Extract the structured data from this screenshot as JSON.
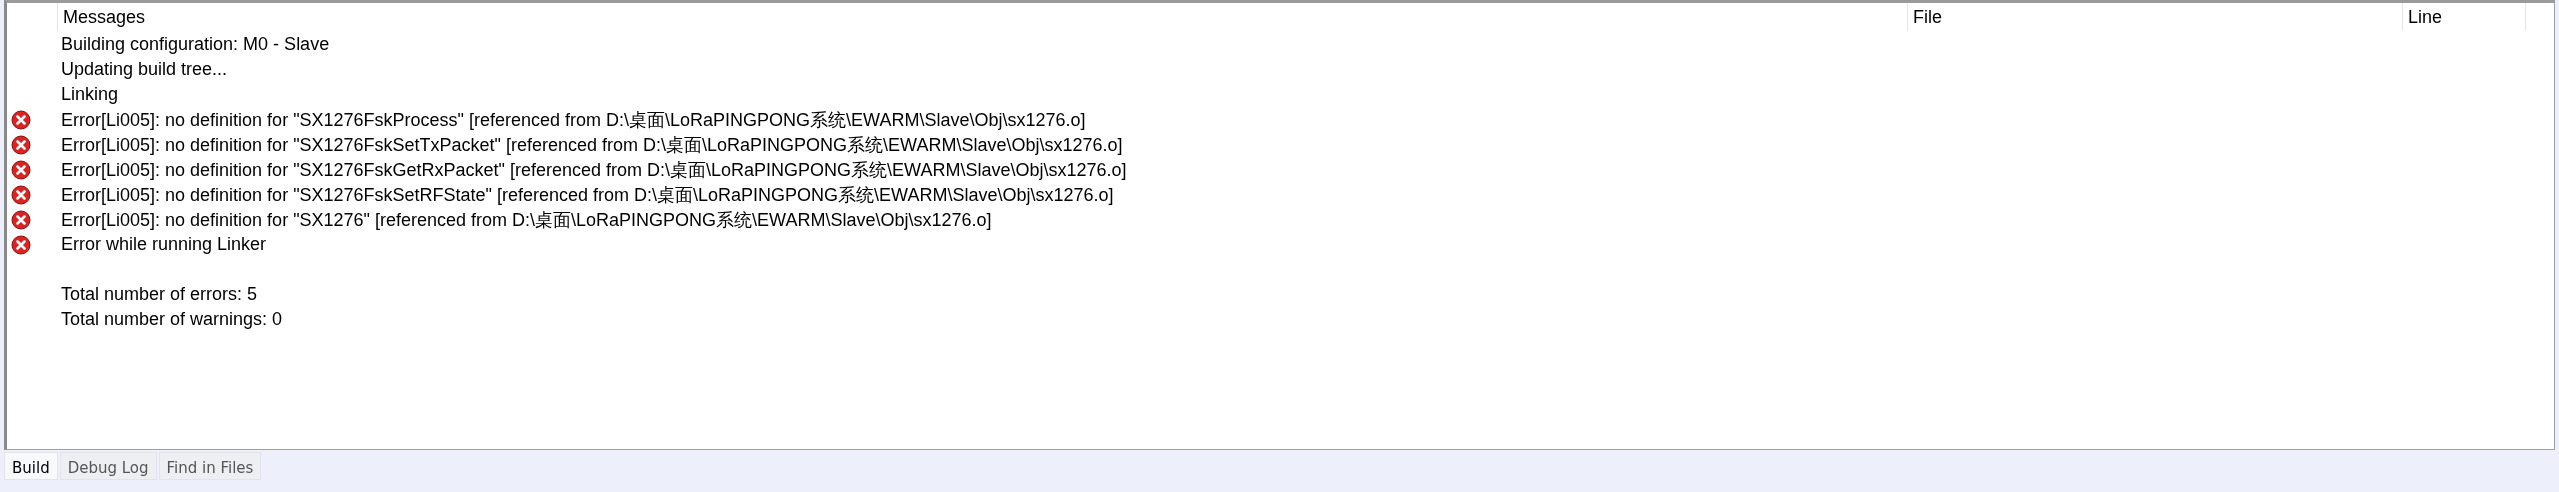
{
  "table": {
    "columns": [
      "Messages",
      "File",
      "Line"
    ],
    "rows": [
      {
        "kind": "info",
        "text": "Building configuration: M0 - Slave"
      },
      {
        "kind": "info",
        "text": "Updating build tree..."
      },
      {
        "kind": "info",
        "text": "Linking"
      },
      {
        "kind": "error",
        "text": "Error[Li005]: no definition for \"SX1276FskProcess\" [referenced from D:\\桌面\\LoRaPINGPONG系统\\EWARM\\Slave\\Obj\\sx1276.o]"
      },
      {
        "kind": "error",
        "text": "Error[Li005]: no definition for \"SX1276FskSetTxPacket\" [referenced from D:\\桌面\\LoRaPINGPONG系统\\EWARM\\Slave\\Obj\\sx1276.o]"
      },
      {
        "kind": "error",
        "text": "Error[Li005]: no definition for \"SX1276FskGetRxPacket\" [referenced from D:\\桌面\\LoRaPINGPONG系统\\EWARM\\Slave\\Obj\\sx1276.o]"
      },
      {
        "kind": "error",
        "text": "Error[Li005]: no definition for \"SX1276FskSetRFState\" [referenced from D:\\桌面\\LoRaPINGPONG系统\\EWARM\\Slave\\Obj\\sx1276.o]"
      },
      {
        "kind": "error",
        "text": "Error[Li005]: no definition for \"SX1276\" [referenced from D:\\桌面\\LoRaPINGPONG系统\\EWARM\\Slave\\Obj\\sx1276.o]"
      },
      {
        "kind": "error",
        "text": "Error while running Linker"
      },
      {
        "kind": "summary",
        "text": "Total number of errors: 5"
      },
      {
        "kind": "info",
        "text": "Total number of warnings: 0"
      }
    ]
  },
  "tabs": [
    {
      "label": "Build",
      "selected": true
    },
    {
      "label": "Debug Log",
      "selected": false
    },
    {
      "label": "Find in Files",
      "selected": false
    }
  ]
}
